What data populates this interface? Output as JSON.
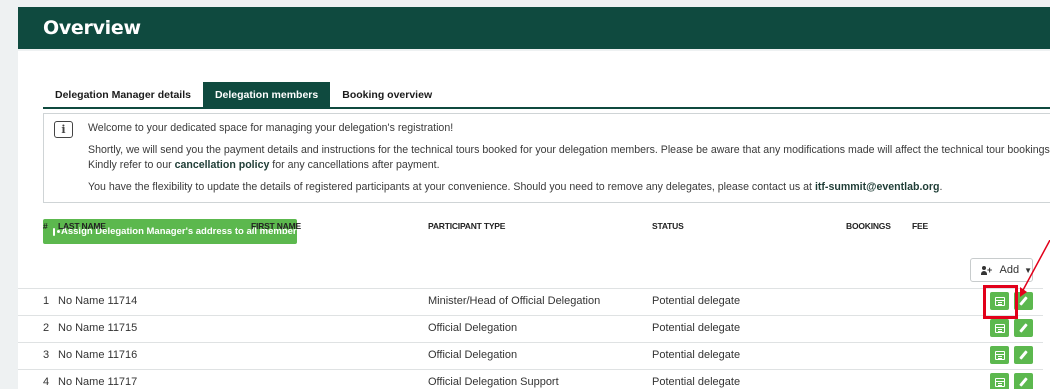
{
  "header": {
    "title": "Overview"
  },
  "tabs": [
    {
      "label": "Delegation Manager details",
      "active": false
    },
    {
      "label": "Delegation members",
      "active": true
    },
    {
      "label": "Booking overview",
      "active": false
    }
  ],
  "info": {
    "line1": "Welcome to your dedicated space for managing your delegation's registration!",
    "line2_pre": "Shortly, we will send you the payment details and instructions for the technical tours booked for your delegation members. Please be aware that any modifications made will affect the technical tour bookings. Kindly refer to our ",
    "line2_link": "cancellation policy",
    "line2_post": " for any cancellations after payment.",
    "line3_pre": "You have the flexibility to update the details of registered participants at your convenience. Should you need to remove any delegates, please contact us at ",
    "line3_email": "itf-summit@eventlab.org",
    "line3_post": "."
  },
  "assign_button": {
    "label": "Assign Delegation Manager's address to all members"
  },
  "add_button": {
    "label": "Add"
  },
  "table": {
    "headers": {
      "num": "#",
      "last_name": "LAST NAME",
      "first_name": "FIRST NAME",
      "participant_type": "PARTICIPANT TYPE",
      "status": "STATUS",
      "bookings": "BOOKINGS",
      "fee": "FEE"
    },
    "rows": [
      {
        "num": "1",
        "last_name": "No Name 11714",
        "first_name": "",
        "participant_type": "Minister/Head of Official Delegation",
        "status": "Potential delegate"
      },
      {
        "num": "2",
        "last_name": "No Name 11715",
        "first_name": "",
        "participant_type": "Official Delegation",
        "status": "Potential delegate"
      },
      {
        "num": "3",
        "last_name": "No Name 11716",
        "first_name": "",
        "participant_type": "Official Delegation",
        "status": "Potential delegate"
      },
      {
        "num": "4",
        "last_name": "No Name 11717",
        "first_name": "",
        "participant_type": "Official Delegation Support",
        "status": "Potential delegate"
      }
    ]
  },
  "colors": {
    "brand": "#0f4a3f",
    "action_green": "#5cb84e",
    "highlight_red": "#e2001a"
  },
  "icons": [
    "info-icon",
    "id-card-icon",
    "user-plus-icon",
    "calendar-icon",
    "pencil-icon"
  ]
}
